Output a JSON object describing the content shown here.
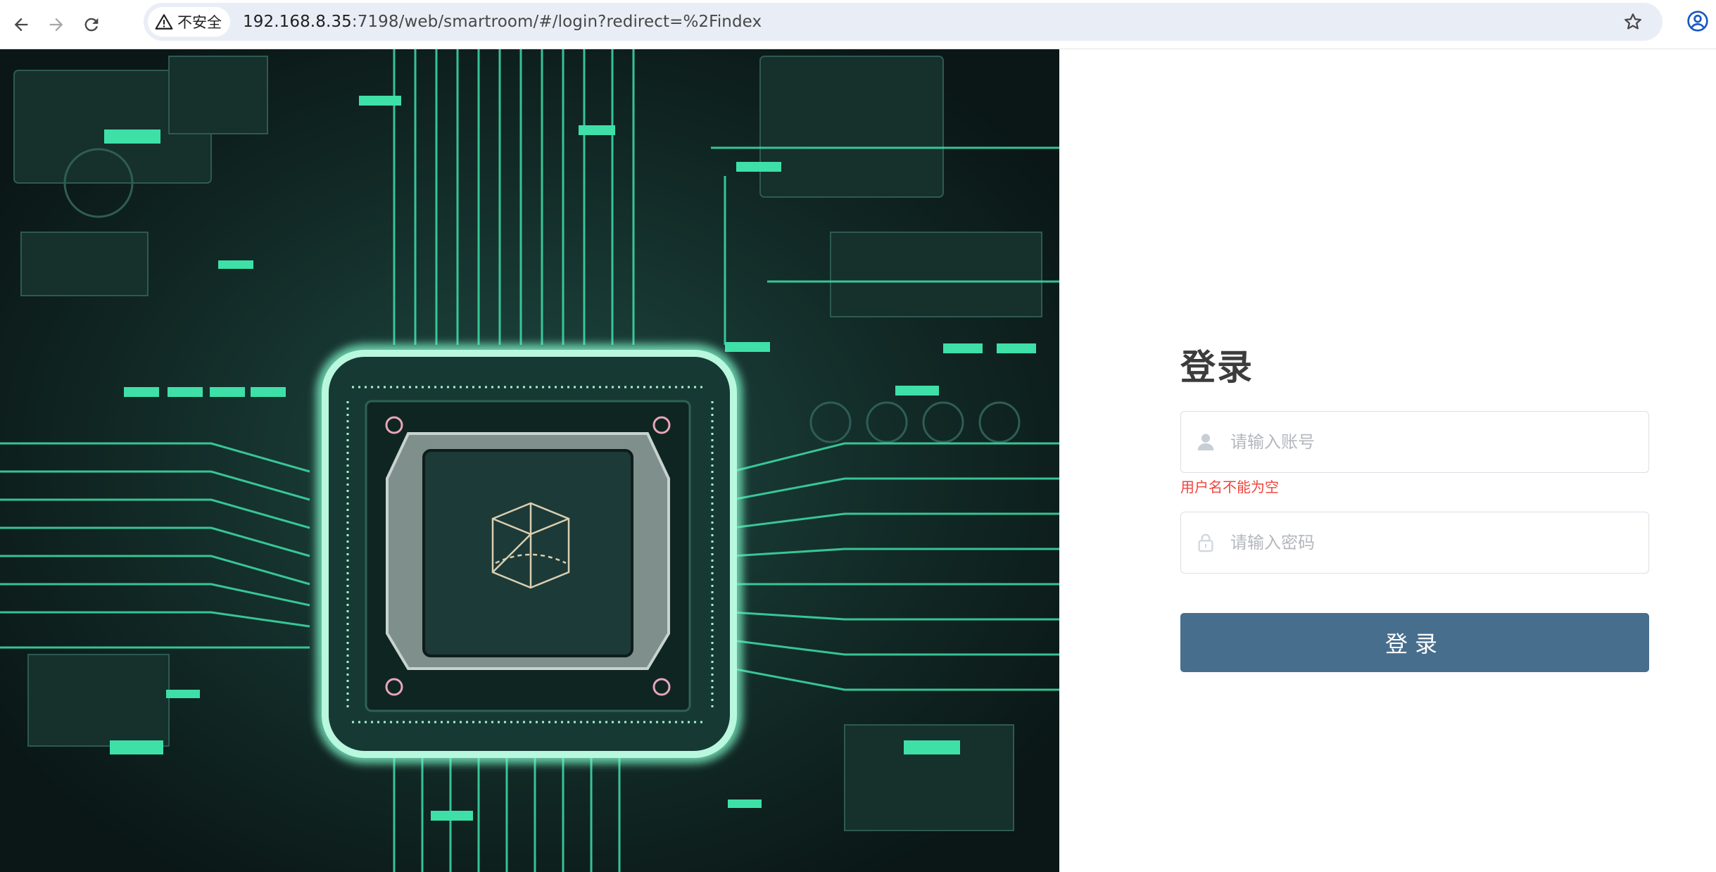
{
  "browser": {
    "security_label": "不安全",
    "url_host": "192.168.8.35",
    "url_rest": ":7198/web/smartroom/#/login?redirect=%2Findex",
    "icons": [
      "back-icon",
      "forward-icon",
      "reload-icon",
      "warning-icon",
      "star-icon",
      "profile-icon"
    ]
  },
  "login": {
    "title": "登录",
    "username_placeholder": "请输入账号",
    "username_error": "用户名不能为空",
    "password_placeholder": "请输入密码",
    "submit_label": "登录"
  },
  "colors": {
    "accent": "#486e8e",
    "error": "#f0433b",
    "circuit_glow": "#3ee0a8",
    "hero_bg": "#0d1f1d"
  }
}
